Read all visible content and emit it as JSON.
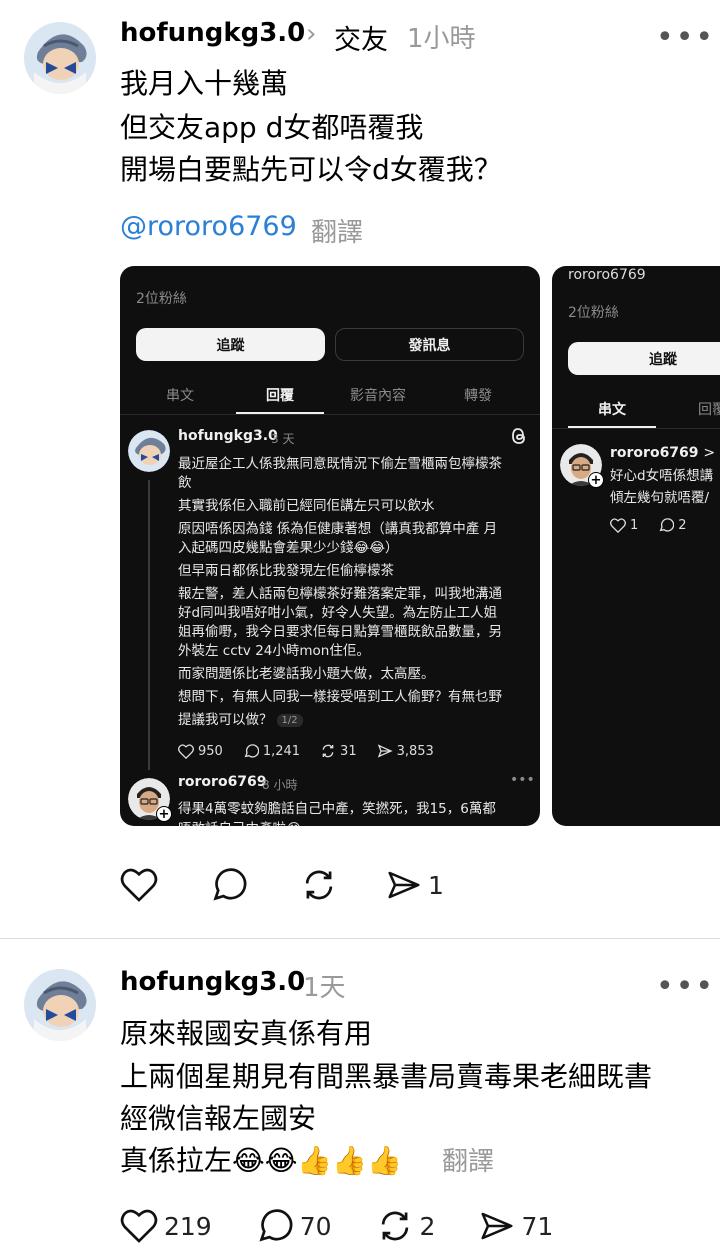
{
  "post1": {
    "username": "hofungkg3.0",
    "topic": "交友",
    "timestamp": "1小時",
    "body": [
      "我月入十幾萬",
      "但交友app d女都唔覆我",
      "開場白要點先可以令d女覆我？"
    ],
    "mention": "@rororo6769",
    "translate_label": "翻譯",
    "actions": {
      "like": "",
      "reply": "",
      "repost": "",
      "share": "1"
    }
  },
  "card1": {
    "followers": "2位粉絲",
    "follow_label": "追蹤",
    "message_label": "發訊息",
    "tabs": [
      "串文",
      "回覆",
      "影音內容",
      "轉發"
    ],
    "thread": {
      "username": "hofungkg3.0",
      "time": "3 天",
      "lines": [
        "最近屋企工人係我無同意既情況下偷左雪櫃兩包檸檬茶",
        "飲",
        "其實我係佢入職前已經同佢講左只可以飲水",
        "原因唔係因為錢 係為佢健康著想（講真我都算中產 月",
        "入起碼四皮幾點會差果少少錢😂😂）",
        "但早兩日都係比我發現左佢偷檸檬茶",
        "報左警，差人話兩包檸檬茶好難落案定罪，叫我地溝通",
        "好d同叫我唔好咁小氣，好令人失望。為左防止工人姐",
        "姐再偷嘢，我今日要求佢每日點算雪櫃既飲品數量，另",
        "外裝左 cctv 24小時mon住佢。",
        "而家問題係比老婆話我小題大做，太高壓。",
        "想問下，有無人同我一樣接受唔到工人偷野？有無乜野",
        "提議我可以做？"
      ],
      "pager": "1/2",
      "likes": "950",
      "replies": "1,241",
      "reposts": "31",
      "shares": "3,853"
    },
    "reply": {
      "username": "rororo6769",
      "time": "8 小時",
      "lines": [
        "得果4萬零蚊夠膽話自己中產，笑撚死，我15，6萬都",
        "唔敢話自己中產啦😂"
      ]
    }
  },
  "card2": {
    "header_name": "rororo6769",
    "followers": "2位粉絲",
    "follow_label": "追蹤",
    "tabs": [
      "串文",
      "回覆"
    ],
    "post": {
      "username": "rororo6769",
      "topic_prefix": "> 交",
      "lines": [
        "好心d女唔係想講",
        "傾左幾句就唔覆/"
      ],
      "likes": "1",
      "replies": "2"
    }
  },
  "post2": {
    "username": "hofungkg3.0",
    "timestamp": "1天",
    "body": [
      "原來報國安真係有用",
      "上兩個星期見有間黑暴書局賣毒果老細既書",
      "經微信報左國安",
      "真係拉左😂😂👍👍👍"
    ],
    "translate_label": "翻譯",
    "actions": {
      "like": "219",
      "reply": "70",
      "repost": "2",
      "share": "71"
    }
  }
}
